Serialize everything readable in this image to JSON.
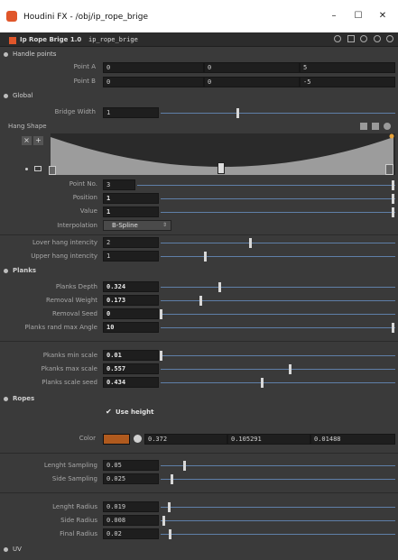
{
  "window": {
    "title": "Houdini FX - /obj/ip_rope_brige",
    "min": "–",
    "max": "☐",
    "close": "✕"
  },
  "node": {
    "type": "Ip Rope Brige 1.0",
    "name": "ip_rope_brige"
  },
  "sections": {
    "handle": "Handle points",
    "global": "Global",
    "planks": "Planks",
    "ropes": "Ropes",
    "uv": "UV"
  },
  "handle": {
    "a_label": "Point A",
    "b_label": "Point B",
    "a": [
      "0",
      "0",
      "5"
    ],
    "b": [
      "0",
      "0",
      "-5"
    ]
  },
  "global": {
    "bw_label": "Bridge Width",
    "bw": "1",
    "hang_label": "Hang Shape",
    "pn_label": "Point No.",
    "pn": "3",
    "pos_label": "Position",
    "pos": "1",
    "val_label": "Value",
    "val": "1",
    "interp_label": "Interpolation",
    "interp": "B-Spline",
    "lower_label": "Lover hang intencity",
    "lower": "2",
    "upper_label": "Upper hang intencity",
    "upper": "1"
  },
  "planks": {
    "depth_label": "Planks Depth",
    "depth": "0.324",
    "rw_label": "Removal Weight",
    "rw": "0.173",
    "rs_label": "Removal Seed",
    "rs": "0",
    "angle_label": "Planks rand max Angle",
    "angle": "10",
    "min_label": "Pkanks min scale",
    "min": "0.01",
    "max_label": "Pkanks max scale",
    "max": "0.557",
    "seed_label": "Planks scale seed",
    "seed": "0.434"
  },
  "ropes": {
    "usehl": "Use height",
    "color_label": "Color",
    "c": [
      "0.372",
      "0.105291",
      "0.01488"
    ],
    "ls_label": "Lenght Sampling",
    "ls": "0.05",
    "ss_label": "Side Sampling",
    "ss": "0.025",
    "lr_label": "Lenght Radius",
    "lr": "0.019",
    "sr_label": "Side Radius",
    "sr": "0.008",
    "fr_label": "Final Radius",
    "fr": "0.02"
  },
  "colors": {
    "rope": "#b05a1e",
    "accent": "#e0562a"
  }
}
